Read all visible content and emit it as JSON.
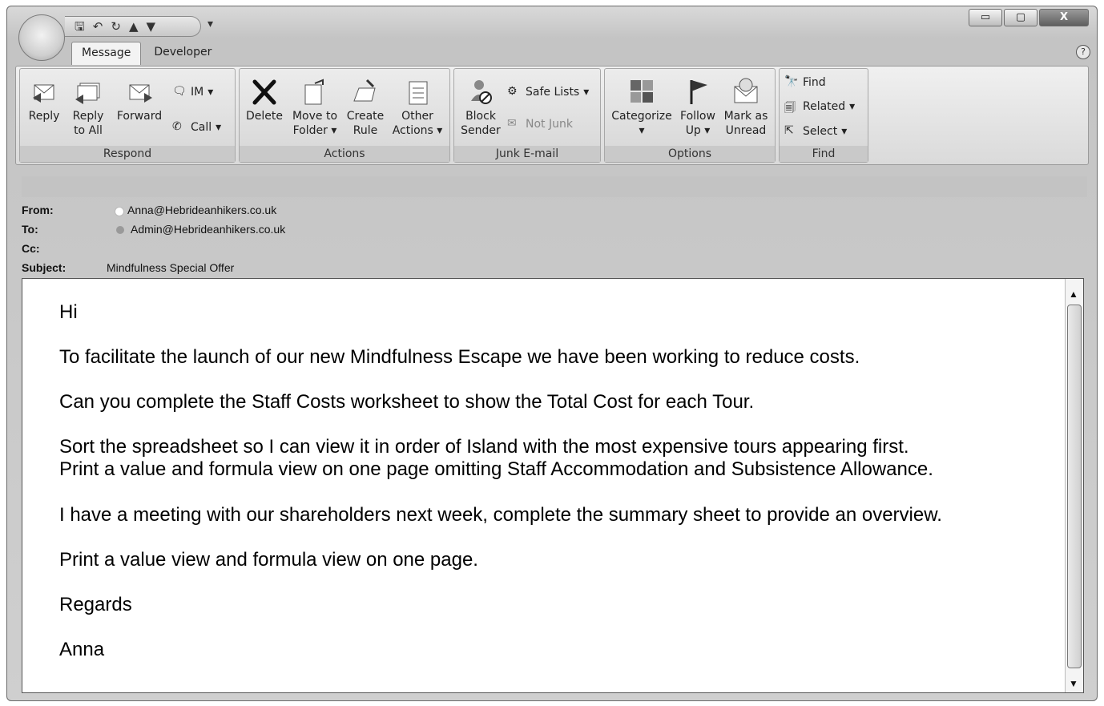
{
  "quick_access": {
    "more": "▾"
  },
  "window_controls": {
    "minimize": "▭",
    "maximize": "▢",
    "close": "X"
  },
  "tabs": [
    {
      "label": "Message"
    },
    {
      "label": "Developer"
    }
  ],
  "ribbon": {
    "respond": {
      "label": "Respond",
      "reply": "Reply",
      "reply_all_1": "Reply",
      "reply_all_2": "to All",
      "forward": "Forward",
      "im": "IM",
      "call": "Call"
    },
    "actions": {
      "label": "Actions",
      "delete": "Delete",
      "move_1": "Move to",
      "move_2": "Folder",
      "create_1": "Create",
      "create_2": "Rule",
      "other_1": "Other",
      "other_2": "Actions"
    },
    "junk": {
      "label": "Junk E-mail",
      "block_1": "Block",
      "block_2": "Sender",
      "safe_lists": "Safe Lists",
      "not_junk": "Not Junk"
    },
    "options": {
      "label": "Options",
      "categorize": "Categorize",
      "follow_1": "Follow",
      "follow_2": "Up",
      "mark_1": "Mark as",
      "mark_2": "Unread"
    },
    "find": {
      "label": "Find",
      "find": "Find",
      "related": "Related",
      "select": "Select"
    }
  },
  "headers": {
    "from_label": "From:",
    "from_value": "Anna@Hebrideanhikers.co.uk",
    "to_label": "To:",
    "to_value": "Admin@Hebrideanhikers.co.uk",
    "cc_label": "Cc:",
    "cc_value": "",
    "subject_label": "Subject:",
    "subject_value": "Mindfulness Special Offer"
  },
  "body": {
    "greeting": "Hi",
    "p1": "To facilitate the launch of our new Mindfulness Escape we have been working to reduce costs.",
    "p2": "Can you complete the Staff Costs worksheet to show the Total Cost for each Tour.",
    "p3a": "Sort the spreadsheet so I can view it in order of Island with the most expensive tours appearing first.",
    "p3b": "Print a value and formula view on one page omitting Staff Accommodation and Subsistence Allowance.",
    "p4": "I have a meeting with our shareholders next week, complete the summary sheet to provide an overview.",
    "p5": "Print a value view and formula view on one page.",
    "closing": "Regards",
    "signature": "Anna"
  }
}
